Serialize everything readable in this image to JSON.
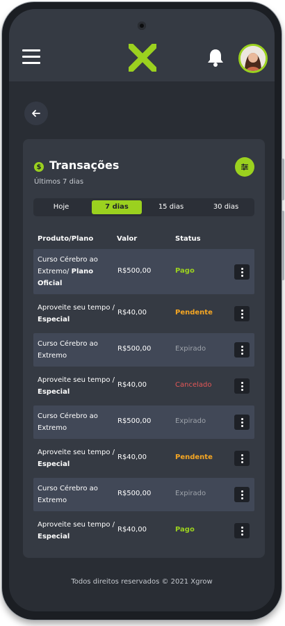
{
  "colors": {
    "accent": "#9bd11f",
    "pending": "#f5a623",
    "cancelled": "#e45757",
    "expired": "#9ea3ab",
    "paid": "#9bd11f"
  },
  "header": {
    "menu_icon": "hamburger-menu-icon",
    "logo_icon": "xgrow-x-logo",
    "bell_icon": "bell-icon",
    "avatar_icon": "user-avatar"
  },
  "back_icon": "arrow-left-icon",
  "card": {
    "title": "Transações",
    "subtitle": "Últimos 7 dias",
    "title_icon": "dollar-coin-icon",
    "coin_symbol": "$",
    "filter_icon": "filter-sliders-icon",
    "tabs": [
      {
        "label": "Hoje",
        "active": false
      },
      {
        "label": "7 dias",
        "active": true
      },
      {
        "label": "15 dias",
        "active": false
      },
      {
        "label": "30 dias",
        "active": false
      }
    ],
    "columns": {
      "product": "Produto/Plano",
      "value": "Valor",
      "status": "Status"
    },
    "rows": [
      {
        "product": "Curso Cérebro ao Extremo/",
        "plan": "Plano Oficial",
        "value": "R$500,00",
        "status": "Pago",
        "status_kind": "paid"
      },
      {
        "product": "Aproveite seu tempo /",
        "plan": "Especial",
        "value": "R$40,00",
        "status": "Pendente",
        "status_kind": "pending"
      },
      {
        "product": "Curso Cérebro ao Extremo",
        "plan": "",
        "value": "R$500,00",
        "status": "Expirado",
        "status_kind": "expired"
      },
      {
        "product": "Aproveite seu tempo /",
        "plan": "Especial",
        "value": "R$40,00",
        "status": "Cancelado",
        "status_kind": "cancelled"
      },
      {
        "product": "Curso Cérebro ao Extremo",
        "plan": "",
        "value": "R$500,00",
        "status": "Expirado",
        "status_kind": "expired"
      },
      {
        "product": "Aproveite seu tempo /",
        "plan": "Especial",
        "value": "R$40,00",
        "status": "Pendente",
        "status_kind": "pending"
      },
      {
        "product": "Curso Cérebro ao Extremo",
        "plan": "",
        "value": "R$500,00",
        "status": "Expirado",
        "status_kind": "expired"
      },
      {
        "product": "Aproveite seu tempo /",
        "plan": "Especial",
        "value": "R$40,00",
        "status": "Pago",
        "status_kind": "paid"
      }
    ],
    "row_action_icon": "more-vertical-icon"
  },
  "footer": {
    "text": "Todos direitos reservados © 2021 Xgrow"
  }
}
